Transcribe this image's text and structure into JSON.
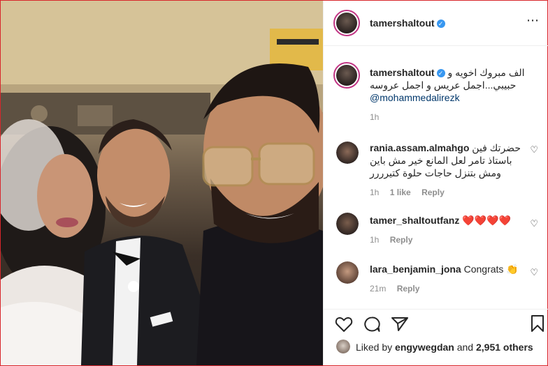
{
  "post_author": {
    "username": "tamershaltout",
    "verified": true
  },
  "caption": {
    "username": "tamershaltout",
    "line1": "الف مبروك اخويه و",
    "line2": "حبيبي...اجمل عريس و اجمل عروسه",
    "mention": "@mohammedalirezk",
    "time": "1h"
  },
  "comments": [
    {
      "username": "rania.assam.almahgo",
      "lines": [
        "حضرتك فين",
        "باستاذ تامر لعل المانع خير مش باين",
        "ومش بتنزل حاجات حلوة كتيرررر"
      ],
      "time": "1h",
      "likes": "1 like",
      "reply": "Reply"
    },
    {
      "username": "tamer_shaltoutfanz",
      "text": "❤️❤️❤️❤️",
      "time": "1h",
      "reply": "Reply"
    },
    {
      "username": "lara_benjamin_jona",
      "text": "Congrats 👏",
      "time": "21m",
      "reply": "Reply"
    }
  ],
  "actions": {
    "like": "heart-icon",
    "comment": "comment-icon",
    "share": "paper-plane-icon",
    "save": "bookmark-icon"
  },
  "likes": {
    "prefix": "Liked by",
    "user": "engywegdan",
    "and": "and",
    "others": "2,951 others"
  },
  "colors": {
    "verified": "#3897f0",
    "story_ring": "#c13584",
    "mention": "#00376b",
    "border": "#d8262b"
  }
}
